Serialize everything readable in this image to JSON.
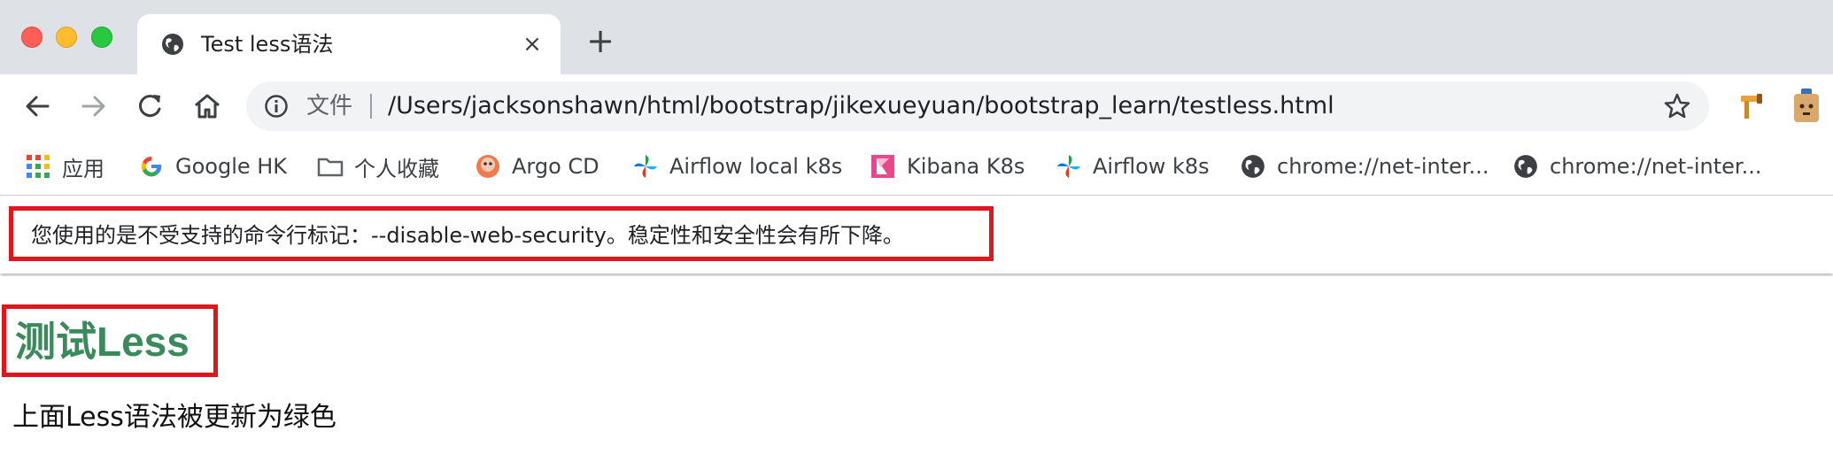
{
  "window": {
    "tab_title": "Test less语法",
    "tab_close": "×",
    "new_tab": "+"
  },
  "omnibox": {
    "scheme_label": "文件",
    "url": "/Users/jacksonshawn/html/bootstrap/jikexueyuan/bootstrap_learn/testless.html"
  },
  "bookmarks": [
    {
      "label": "应用",
      "icon": "apps-grid-icon"
    },
    {
      "label": "Google HK",
      "icon": "google-icon"
    },
    {
      "label": "个人收藏",
      "icon": "folder-icon"
    },
    {
      "label": "Argo CD",
      "icon": "argo-icon"
    },
    {
      "label": "Airflow local k8s",
      "icon": "airflow-icon"
    },
    {
      "label": "Kibana K8s",
      "icon": "kibana-icon"
    },
    {
      "label": "Airflow k8s",
      "icon": "airflow-icon"
    },
    {
      "label": "chrome://net-inter...",
      "icon": "globe-icon"
    },
    {
      "label": "chrome://net-inter...",
      "icon": "globe-icon"
    }
  ],
  "infobar": {
    "message": "您使用的是不受支持的命令行标记：--disable-web-security。稳定性和安全性会有所下降。"
  },
  "page": {
    "heading": "测试Less",
    "paragraph": "上面Less语法被更新为绿色"
  },
  "colors": {
    "heading_green": "#3a8a5c",
    "highlight_red": "#e0161c",
    "tabstrip_bg": "#dee1e6"
  }
}
